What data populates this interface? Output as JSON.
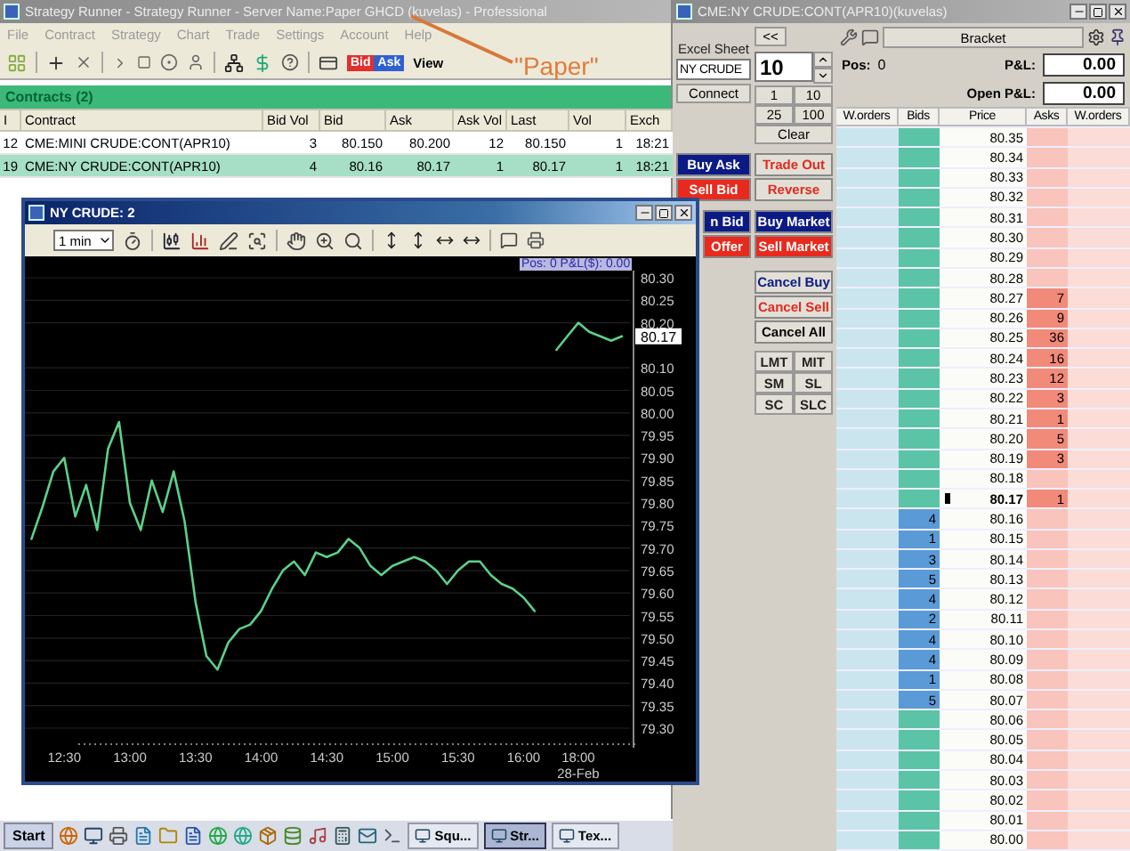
{
  "main_window": {
    "title": "Strategy Runner - Strategy Runner - Server Name:Paper GHCD (kuvelas) - Professional",
    "menu": [
      "File",
      "Contract",
      "Strategy",
      "Chart",
      "Trade",
      "Settings",
      "Account",
      "Help"
    ],
    "toolbar": {
      "bid_label": "Bid",
      "ask_label": "Ask",
      "view_label": "View"
    },
    "contracts": {
      "title": "Contracts (2)",
      "columns": [
        "I",
        "Contract",
        "Bid Vol",
        "Bid",
        "Ask",
        "Ask Vol",
        "Last",
        "Vol",
        "Exch"
      ],
      "rows": [
        {
          "cells": [
            "12",
            "CME:MINI CRUDE:CONT(APR10)",
            "3",
            "80.150",
            "80.200",
            "12",
            "80.150",
            "1",
            "18:21"
          ],
          "selected": false
        },
        {
          "cells": [
            "19",
            "CME:NY CRUDE:CONT(APR10)",
            "4",
            "80.16",
            "80.17",
            "1",
            "80.17",
            "1",
            "18:21"
          ],
          "selected": true
        }
      ]
    }
  },
  "annotation": {
    "text": "\"Paper\""
  },
  "chart_window": {
    "title": "NY CRUDE: 2",
    "interval": "1 min",
    "position_label": "Pos: 0 P&L($): 0.00",
    "last_price": "80.17",
    "chart_data": {
      "type": "line",
      "xlabel": "28-Feb",
      "categories": [
        null,
        null,
        null,
        "12:30",
        null,
        null,
        null,
        null,
        null,
        "13:00",
        null,
        null,
        null,
        null,
        null,
        "13:30",
        null,
        null,
        null,
        null,
        null,
        "14:00",
        null,
        null,
        null,
        null,
        null,
        "14:30",
        null,
        null,
        null,
        null,
        null,
        "15:00",
        null,
        null,
        null,
        null,
        null,
        "15:30",
        null,
        null,
        null,
        null,
        null,
        "16:00",
        null,
        null,
        null,
        null,
        "18:00",
        null,
        null,
        null,
        null
      ],
      "series": [
        {
          "color": "#5cd08a",
          "values": [
            79.72,
            79.79,
            79.87,
            79.9,
            79.77,
            79.84,
            79.74,
            79.92,
            79.98,
            79.8,
            79.74,
            79.85,
            79.78,
            79.87,
            79.76,
            79.58,
            79.46,
            79.43,
            79.49,
            79.52,
            79.53,
            79.56,
            79.61,
            79.65,
            79.67,
            79.64,
            79.69,
            79.68,
            79.69,
            79.72,
            79.7,
            79.66,
            79.64,
            79.66,
            79.67,
            79.68,
            79.67,
            79.65,
            79.62,
            79.65,
            79.67,
            79.67,
            79.64,
            79.62,
            79.61,
            79.59,
            79.56,
            null,
            80.14,
            80.17,
            80.2,
            80.18,
            80.17,
            80.16,
            80.17
          ]
        }
      ],
      "ylim": [
        79.3,
        80.3
      ],
      "grid": true,
      "yticks": [
        {
          "value": 80.3,
          "label": "80.30"
        },
        {
          "value": 80.25,
          "label": "80.25"
        },
        {
          "value": 80.2,
          "label": "80.20"
        },
        {
          "value": 80.1,
          "label": "80.10"
        },
        {
          "value": 80.05,
          "label": "80.05"
        },
        {
          "value": 80.0,
          "label": "80.00"
        },
        {
          "value": 79.95,
          "label": "79.95"
        },
        {
          "value": 79.9,
          "label": "79.90"
        },
        {
          "value": 79.85,
          "label": "79.85"
        },
        {
          "value": 79.8,
          "label": "79.80"
        },
        {
          "value": 79.75,
          "label": "79.75"
        },
        {
          "value": 79.7,
          "label": "79.70"
        },
        {
          "value": 79.65,
          "label": "79.65"
        },
        {
          "value": 79.6,
          "label": "79.60"
        },
        {
          "value": 79.55,
          "label": "79.55"
        },
        {
          "value": 79.5,
          "label": "79.50"
        },
        {
          "value": 79.45,
          "label": "79.45"
        },
        {
          "value": 79.4,
          "label": "79.40"
        },
        {
          "value": 79.35,
          "label": "79.35"
        },
        {
          "value": 79.3,
          "label": "79.30"
        }
      ]
    }
  },
  "dom_window": {
    "title": "CME:NY CRUDE:CONT(APR10)(kuvelas)",
    "collapse_button": "<<",
    "excel_sheet_label": "Excel Sheet",
    "excel_sheet_value": "NY CRUDE",
    "quantity": "10",
    "connect_button": "Connect",
    "quantity_buttons": [
      "1",
      "10",
      "25",
      "100"
    ],
    "clear_button": "Clear",
    "left_buttons": [
      {
        "label": "Buy Ask",
        "kind": "buy_fill"
      },
      {
        "label": "Sell Bid",
        "kind": "sell_fill"
      },
      {
        "label": "n Bid",
        "kind": "buy_fill"
      },
      {
        "label": "Offer",
        "kind": "sell_fill"
      }
    ],
    "right_buttons": [
      {
        "label": "Trade Out",
        "kind": "sell_text"
      },
      {
        "label": "Reverse",
        "kind": "sell_text"
      },
      {
        "label": "Buy Market",
        "kind": "buy_fill"
      },
      {
        "label": "Sell Market",
        "kind": "sell_fill"
      }
    ],
    "cancel_buttons": [
      {
        "label": "Cancel Buy",
        "kind": "buy_text"
      },
      {
        "label": "Cancel Sell",
        "kind": "sell_text"
      },
      {
        "label": "Cancel All",
        "kind": "plain"
      }
    ],
    "order_types": [
      "LMT",
      "MIT",
      "SM",
      "SL",
      "SC",
      "SLC"
    ],
    "bracket_button": "Bracket",
    "position": {
      "label": "Pos:",
      "value": "0"
    },
    "pnl": {
      "label": "P&L:",
      "value": "0.00"
    },
    "open_pnl": {
      "label": "Open P&L:",
      "value": "0.00"
    },
    "ladder": {
      "columns": [
        "W.orders",
        "Bids",
        "Price",
        "Asks",
        "W.orders"
      ],
      "rows": [
        {
          "price": "80.35",
          "current": false
        },
        {
          "price": "80.34",
          "current": false
        },
        {
          "price": "80.33",
          "current": false
        },
        {
          "price": "80.32",
          "current": false
        },
        {
          "price": "80.31",
          "current": false
        },
        {
          "price": "80.30",
          "current": false
        },
        {
          "price": "80.29",
          "current": false
        },
        {
          "price": "80.28",
          "current": false
        },
        {
          "price": "80.27",
          "ask": "7",
          "current": false
        },
        {
          "price": "80.26",
          "ask": "9",
          "current": false
        },
        {
          "price": "80.25",
          "ask": "36",
          "current": false
        },
        {
          "price": "80.24",
          "ask": "16",
          "current": false
        },
        {
          "price": "80.23",
          "ask": "12",
          "current": false
        },
        {
          "price": "80.22",
          "ask": "3",
          "current": false
        },
        {
          "price": "80.21",
          "ask": "1",
          "current": false
        },
        {
          "price": "80.20",
          "ask": "5",
          "current": false
        },
        {
          "price": "80.19",
          "ask": "3",
          "current": false
        },
        {
          "price": "80.18",
          "current": false
        },
        {
          "price": "80.17",
          "ask": "1",
          "current": true
        },
        {
          "price": "80.16",
          "bid": "4",
          "current": false
        },
        {
          "price": "80.15",
          "bid": "1",
          "current": false
        },
        {
          "price": "80.14",
          "bid": "3",
          "current": false
        },
        {
          "price": "80.13",
          "bid": "5",
          "current": false
        },
        {
          "price": "80.12",
          "bid": "4",
          "current": false
        },
        {
          "price": "80.11",
          "bid": "2",
          "current": false
        },
        {
          "price": "80.10",
          "bid": "4",
          "current": false
        },
        {
          "price": "80.09",
          "bid": "4",
          "current": false
        },
        {
          "price": "80.08",
          "bid": "1",
          "current": false
        },
        {
          "price": "80.07",
          "bid": "5",
          "current": false
        },
        {
          "price": "80.06",
          "current": false
        },
        {
          "price": "80.05",
          "current": false
        },
        {
          "price": "80.04",
          "current": false
        },
        {
          "price": "80.03",
          "current": false
        },
        {
          "price": "80.02",
          "current": false
        },
        {
          "price": "80.01",
          "current": false
        },
        {
          "price": "80.00",
          "current": false
        }
      ]
    }
  },
  "taskbar": {
    "start": "Start",
    "tasks": [
      {
        "label": "Squ...",
        "selected": false
      },
      {
        "label": "Str...",
        "selected": true
      },
      {
        "label": "Tex...",
        "selected": false
      }
    ]
  }
}
